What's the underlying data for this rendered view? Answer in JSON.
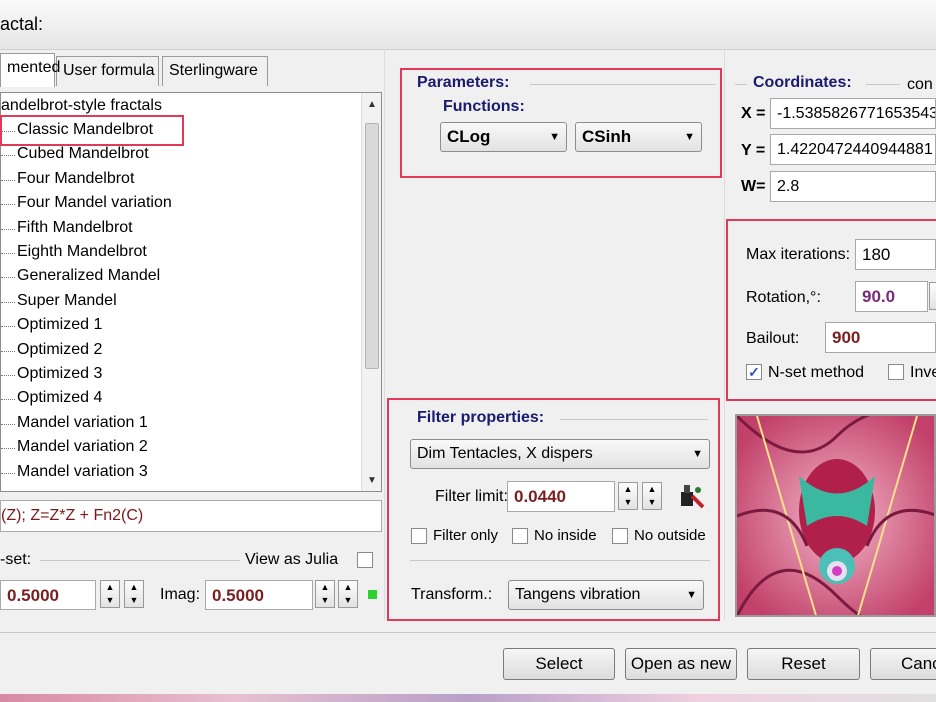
{
  "window": {
    "title": "actal:"
  },
  "tabs": [
    {
      "label": "mented"
    },
    {
      "label": "User formula"
    },
    {
      "label": "Sterlingware"
    }
  ],
  "tree": {
    "root": "andelbrot-style fractals",
    "items": [
      "Classic Mandelbrot",
      "Cubed Mandelbrot",
      "Four Mandelbrot",
      "Four Mandel variation",
      "Fifth Mandelbrot",
      "Eighth Mandelbrot",
      "Generalized Mandel",
      "Super Mandel",
      "Optimized 1",
      "Optimized 2",
      "Optimized 3",
      "Optimized 4",
      "Mandel variation 1",
      "Mandel variation 2",
      "Mandel variation 3"
    ],
    "selected": "Classic Mandelbrot"
  },
  "formula": "(Z); Z=Z*Z + Fn2(C)",
  "nset": {
    "label": "-set:",
    "view_as_julia": "View as Julia",
    "real_value": "0.5000",
    "imag_label": "Imag:",
    "imag_value": "0.5000"
  },
  "parameters": {
    "title": "Parameters:",
    "functions_label": "Functions:",
    "fn1": "CLog",
    "fn2": "CSinh"
  },
  "filter": {
    "title": "Filter properties:",
    "selected": "Dim Tentacles, X dispers",
    "limit_label": "Filter limit:",
    "limit_value": "0.0440",
    "filter_only": "Filter only",
    "no_inside": "No inside",
    "no_outside": "No outside",
    "transform_label": "Transform.:",
    "transform_value": "Tangens vibration"
  },
  "coordinates": {
    "title": "Coordinates:",
    "extra": "con",
    "x_label": "X =",
    "x_value": "-1.5385826771653543",
    "y_label": "Y =",
    "y_value": "1.4220472440944881",
    "w_label": "W=",
    "w_value": "2.8"
  },
  "iterations": {
    "max_label": "Max iterations:",
    "max_value": "180",
    "rotation_label": "Rotation,°:",
    "rotation_value": "90.0",
    "bailout_label": "Bailout:",
    "bailout_value": "900",
    "nset_method": "N-set method",
    "invert": "Inve"
  },
  "buttons": {
    "select": "Select",
    "open_as_new": "Open as new",
    "reset": "Reset",
    "cancel": "Canc"
  },
  "colors": {
    "highlight": "#e0395a",
    "value_red": "#7b1f1f",
    "rotation_purple": "#7a2a7a",
    "group_blue": "#1a1a6e"
  }
}
